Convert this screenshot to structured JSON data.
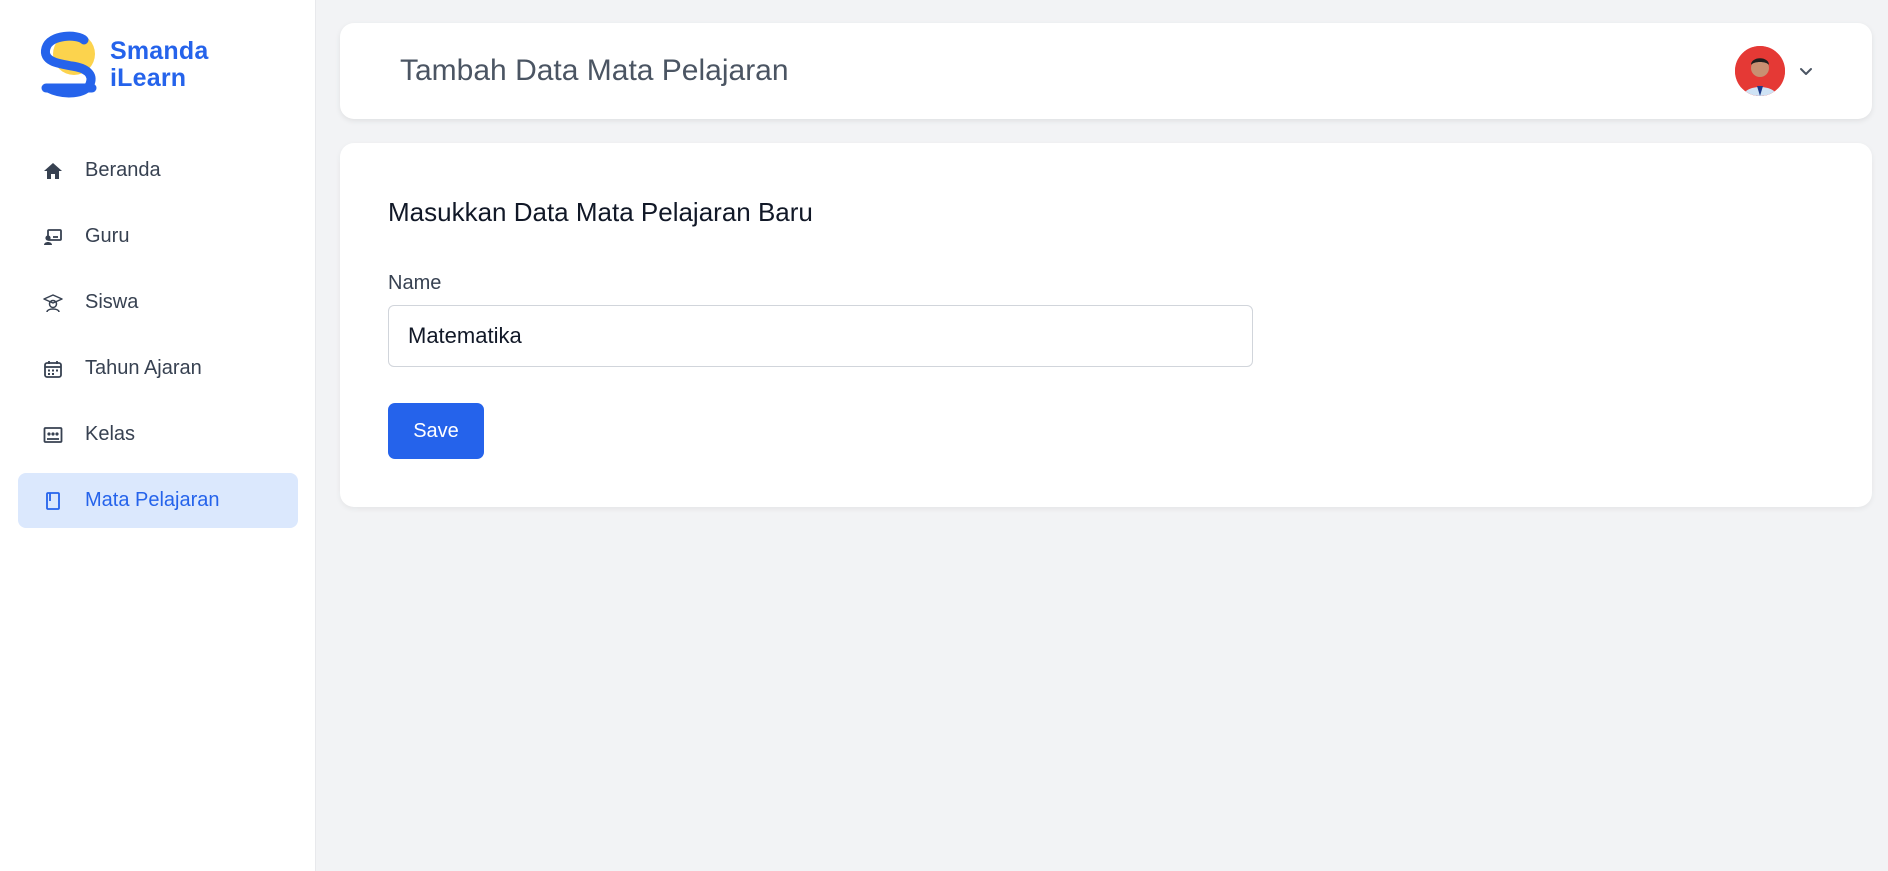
{
  "brand": {
    "line1": "Smanda",
    "line2": "iLearn",
    "primary_color": "#2563eb",
    "accent_color": "#fcd34d"
  },
  "sidebar": {
    "items": [
      {
        "label": "Beranda",
        "icon": "home-icon"
      },
      {
        "label": "Guru",
        "icon": "teacher-icon"
      },
      {
        "label": "Siswa",
        "icon": "student-icon"
      },
      {
        "label": "Tahun Ajaran",
        "icon": "calendar-icon"
      },
      {
        "label": "Kelas",
        "icon": "classroom-icon"
      },
      {
        "label": "Mata Pelajaran",
        "icon": "book-icon",
        "active": true
      }
    ]
  },
  "header": {
    "title": "Tambah Data Mata Pelajaran",
    "user_menu_icon": "chevron-down-icon"
  },
  "form": {
    "title": "Masukkan Data Mata Pelajaran Baru",
    "name_label": "Name",
    "name_value": "Matematika",
    "save_label": "Save"
  }
}
